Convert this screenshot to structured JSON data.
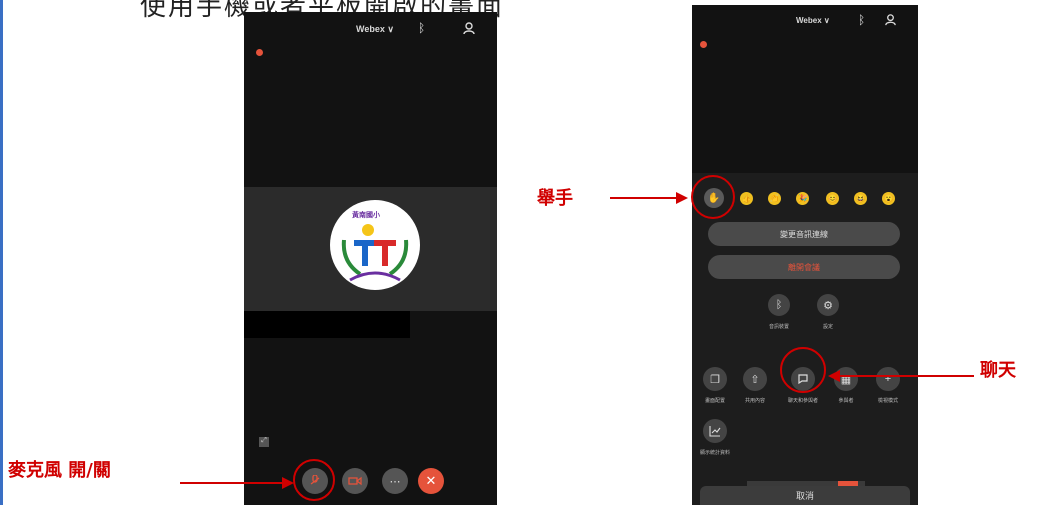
{
  "page": {
    "cut_title": "使用手機或者平板開啟的畫面"
  },
  "left_phone": {
    "top_bar": {
      "app_label": "Webex ∨",
      "bluetooth_icon": "bluetooth-icon",
      "people_icon": "people-icon"
    },
    "logo": {
      "top_text": "黃南國小",
      "letters": "T"
    },
    "controls": {
      "mic": "microphone-icon",
      "camera": "video-icon",
      "more": "⋯",
      "leave": "✕"
    }
  },
  "right_phone": {
    "top_bar": {
      "app_label": "Webex ∨",
      "bluetooth_icon": "bluetooth-icon",
      "people_icon": "people-icon"
    },
    "reactions": [
      "👍",
      "👏",
      "🎉",
      "😊",
      "😆",
      "😮"
    ],
    "menu": {
      "primary_button": "變更音訊連線",
      "danger_button": "離開會議",
      "small_items": [
        {
          "icon": "bluetooth-icon",
          "label": "音訊裝置"
        },
        {
          "icon": "gear-icon",
          "label": "設定"
        }
      ],
      "action_items": [
        {
          "icon": "window-icon",
          "label": "畫面配置"
        },
        {
          "icon": "share-icon",
          "label": "共用內容"
        },
        {
          "icon": "chat-icon",
          "label": "聊天和參與者"
        },
        {
          "icon": "layout-icon",
          "label": "參與者"
        },
        {
          "icon": "mode-icon",
          "label": "檢視模式"
        },
        {
          "icon": "stats-icon",
          "label": "顯示統計資料"
        }
      ],
      "cancel": "取消"
    }
  },
  "annotations": {
    "mic_label": "麥克風 開/關",
    "raise_hand_label": "舉手",
    "chat_label": "聊天"
  },
  "colors": {
    "annotation": "#d00000",
    "leave_button": "#e5533b",
    "phone_bg": "#121212"
  }
}
